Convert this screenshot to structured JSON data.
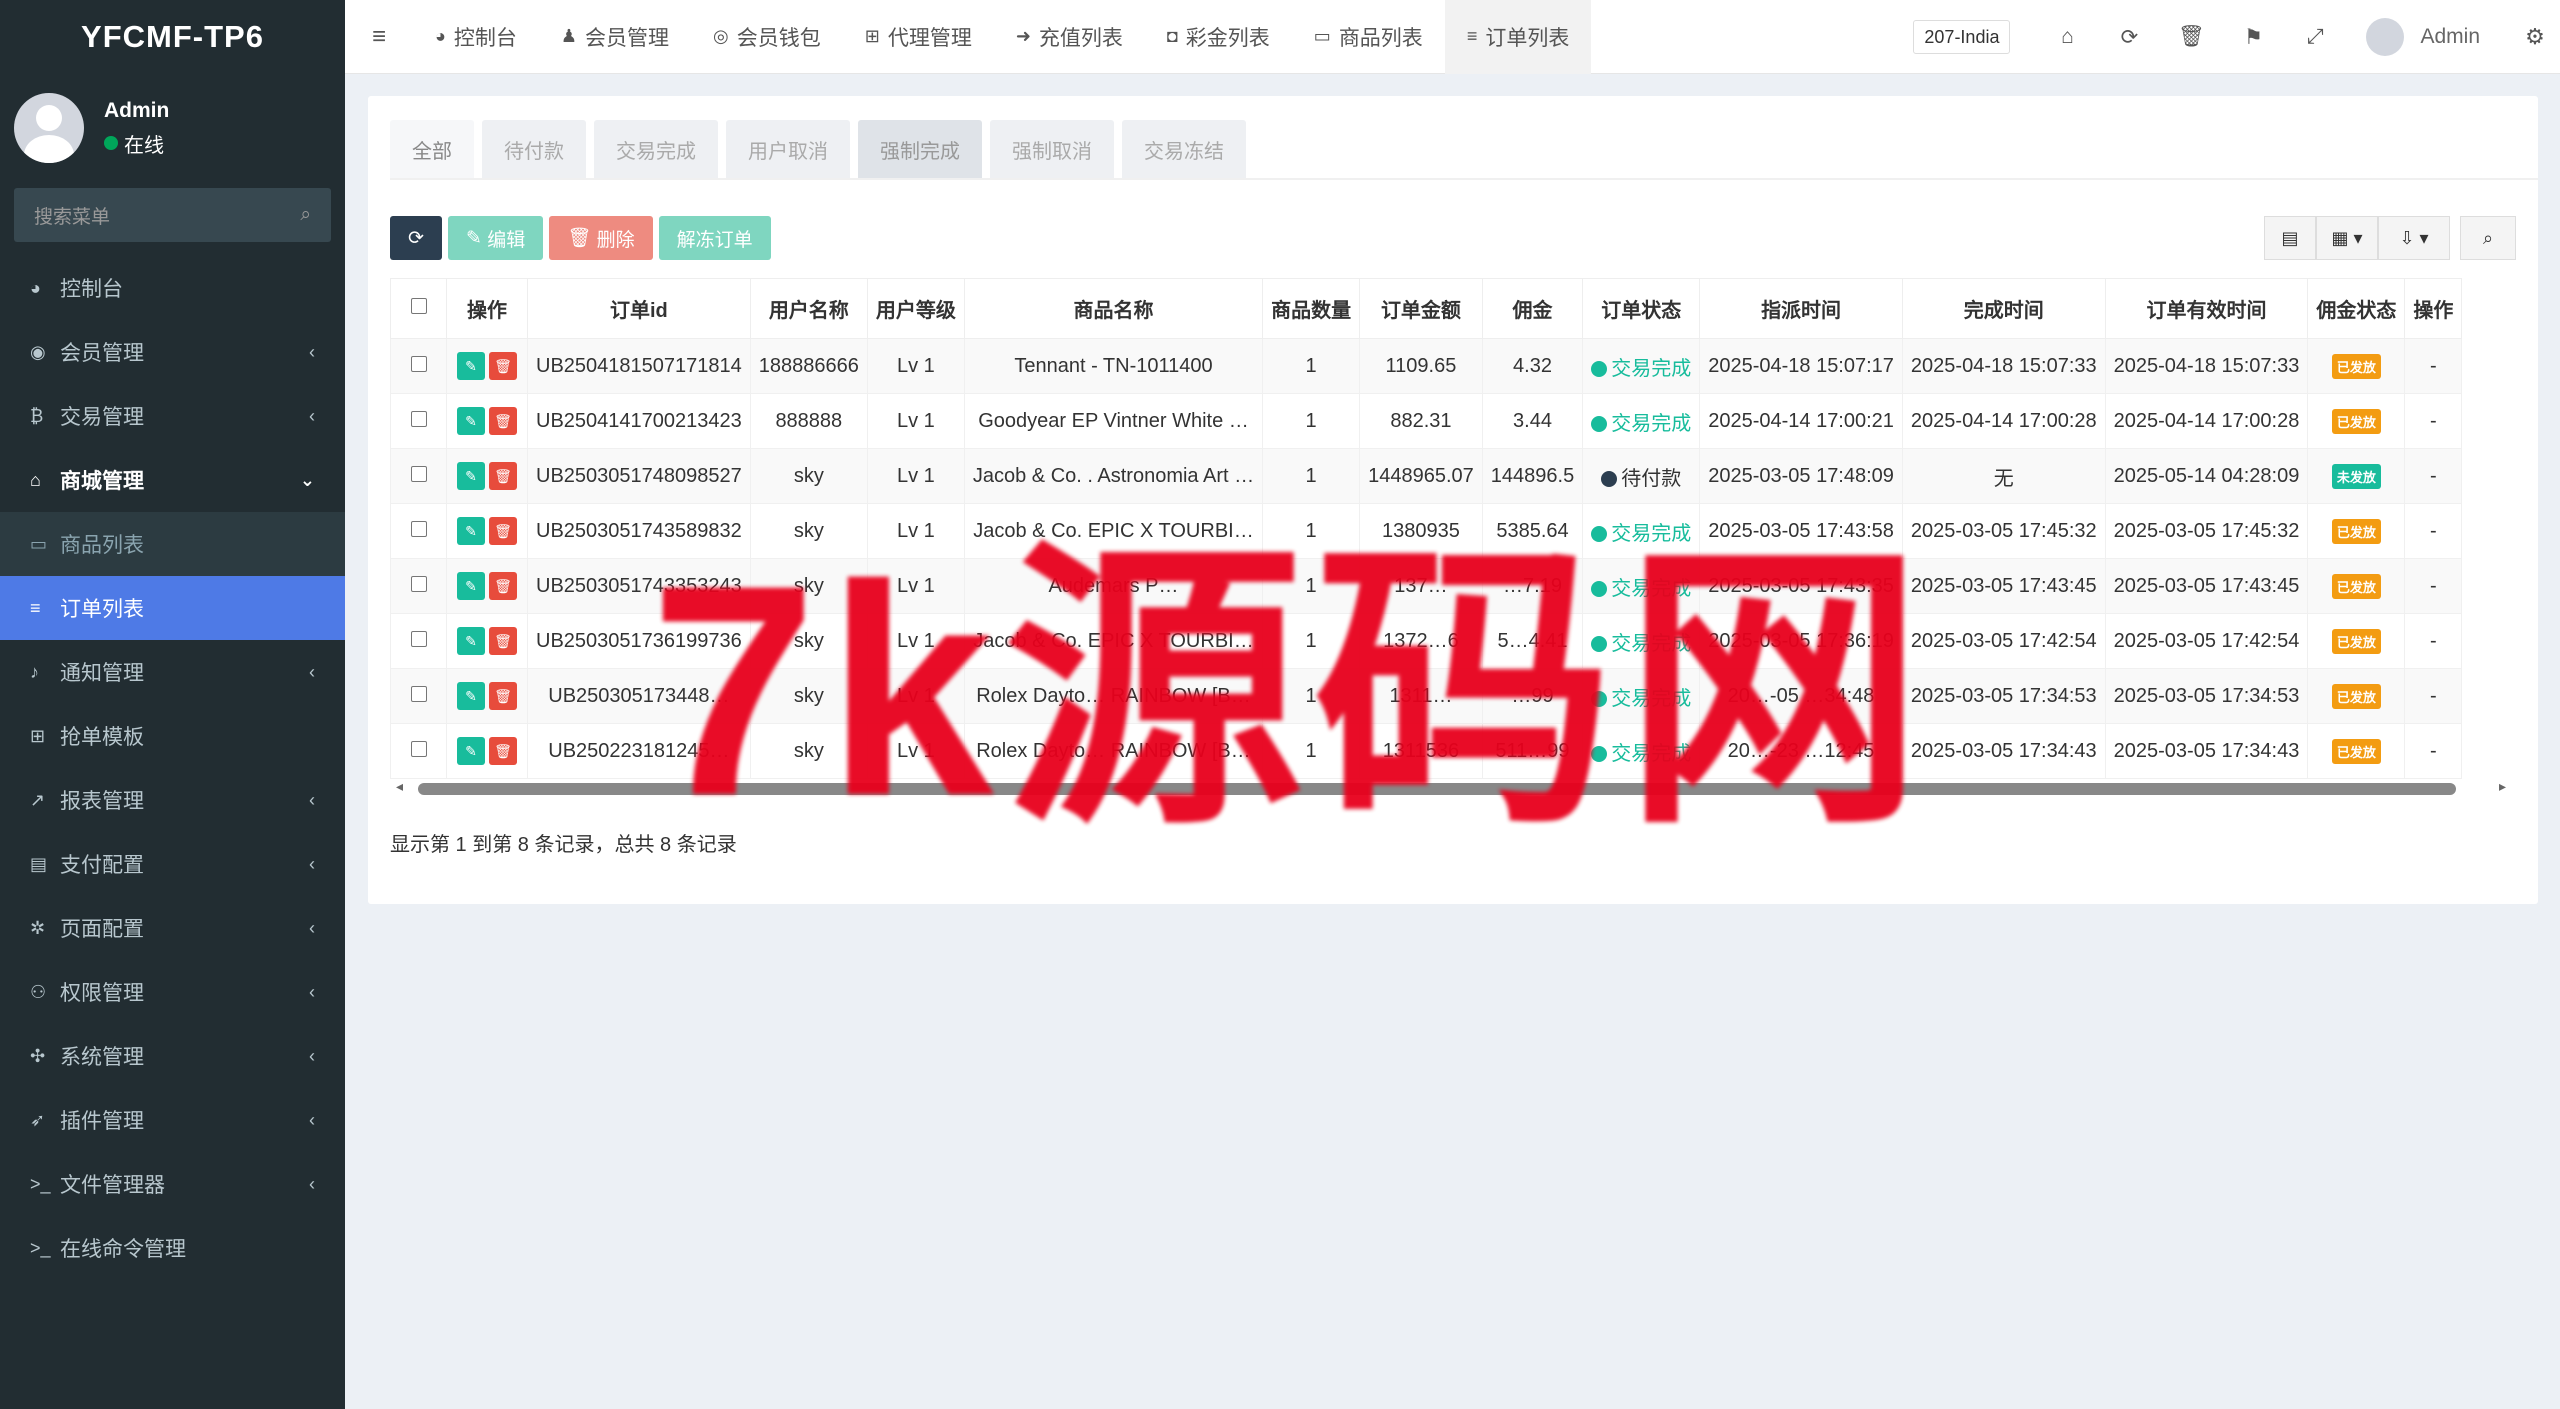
{
  "app": {
    "title": "YFCMF-TP6"
  },
  "user": {
    "name": "Admin",
    "status": "在线"
  },
  "search": {
    "placeholder": "搜索菜单"
  },
  "sidebar": {
    "items": [
      {
        "icon": "dashboard-icon",
        "glyph": "◕",
        "label": "控制台",
        "chevron": ""
      },
      {
        "icon": "user-circle-icon",
        "glyph": "◉",
        "label": "会员管理",
        "chevron": "‹"
      },
      {
        "icon": "bitcoin-icon",
        "glyph": "₿",
        "label": "交易管理",
        "chevron": "‹"
      },
      {
        "icon": "home-icon",
        "glyph": "⌂",
        "label": "商城管理",
        "chevron": "⌄"
      },
      {
        "icon": "monitor-icon",
        "glyph": "▭",
        "label": "商品列表",
        "chevron": ""
      },
      {
        "icon": "list-icon",
        "glyph": "≡",
        "label": "订单列表",
        "chevron": ""
      },
      {
        "icon": "bell-icon",
        "glyph": "♪",
        "label": "通知管理",
        "chevron": "‹"
      },
      {
        "icon": "sitemap-icon",
        "glyph": "⊞",
        "label": "抢单模板",
        "chevron": ""
      },
      {
        "icon": "chart-icon",
        "glyph": "↗",
        "label": "报表管理",
        "chevron": "‹"
      },
      {
        "icon": "credit-card-icon",
        "glyph": "▤",
        "label": "支付配置",
        "chevron": "‹"
      },
      {
        "icon": "gear-icon",
        "glyph": "✲",
        "label": "页面配置",
        "chevron": "‹"
      },
      {
        "icon": "users-icon",
        "glyph": "⚇",
        "label": "权限管理",
        "chevron": "‹"
      },
      {
        "icon": "cogs-icon",
        "glyph": "✣",
        "label": "系统管理",
        "chevron": "‹"
      },
      {
        "icon": "rocket-icon",
        "glyph": "➶",
        "label": "插件管理",
        "chevron": "‹"
      },
      {
        "icon": "terminal-icon",
        "glyph": ">_",
        "label": "文件管理器",
        "chevron": "‹"
      },
      {
        "icon": "terminal-icon",
        "glyph": ">_",
        "label": "在线命令管理",
        "chevron": ""
      }
    ]
  },
  "topnav": {
    "tabs": [
      {
        "icon": "dashboard-icon",
        "glyph": "◕",
        "label": "控制台"
      },
      {
        "icon": "user-icon",
        "glyph": "♟",
        "label": "会员管理"
      },
      {
        "icon": "wallet-icon",
        "glyph": "◎",
        "label": "会员钱包"
      },
      {
        "icon": "sitemap-icon",
        "glyph": "⊞",
        "label": "代理管理"
      },
      {
        "icon": "sign-in-icon",
        "glyph": "➜",
        "label": "充值列表"
      },
      {
        "icon": "gift-icon",
        "glyph": "◘",
        "label": "彩金列表"
      },
      {
        "icon": "monitor-icon",
        "glyph": "▭",
        "label": "商品列表"
      },
      {
        "icon": "list-icon",
        "glyph": "≡",
        "label": "订单列表"
      }
    ],
    "site": "207-India",
    "admin": "Admin"
  },
  "subtabs": [
    "全部",
    "待付款",
    "交易完成",
    "用户取消",
    "强制完成",
    "强制取消",
    "交易冻结"
  ],
  "toolbar": {
    "edit": "编辑",
    "delete": "删除",
    "unfreeze": "解冻订单"
  },
  "table": {
    "headers": [
      "操作",
      "订单id",
      "用户名称",
      "用户等级",
      "商品名称",
      "商品数量",
      "订单金额",
      "佣金",
      "订单状态",
      "指派时间",
      "完成时间",
      "订单有效时间",
      "佣金状态",
      "操作"
    ],
    "rows": [
      {
        "id": "UB2504181507171814",
        "user": "188886666",
        "level": "Lv 1",
        "product": "Tennant - TN-1011400",
        "qty": "1",
        "amount": "1109.65",
        "commission": "4.32",
        "status": "交易完成",
        "assigned": "2025-04-18 15:07:17",
        "completed": "2025-04-18 15:07:33",
        "valid": "2025-04-18 15:07:33",
        "cstatus": "已发放"
      },
      {
        "id": "UB2504141700213423",
        "user": "888888",
        "level": "Lv 1",
        "product": "Goodyear EP Vintner White …",
        "qty": "1",
        "amount": "882.31",
        "commission": "3.44",
        "status": "交易完成",
        "assigned": "2025-04-14 17:00:21",
        "completed": "2025-04-14 17:00:28",
        "valid": "2025-04-14 17:00:28",
        "cstatus": "已发放"
      },
      {
        "id": "UB2503051748098527",
        "user": "sky",
        "level": "Lv 1",
        "product": "Jacob & Co. . Astronomia Art …",
        "qty": "1",
        "amount": "1448965.07",
        "commission": "144896.5",
        "status": "待付款",
        "assigned": "2025-03-05 17:48:09",
        "completed": "无",
        "valid": "2025-05-14 04:28:09",
        "cstatus": "未发放"
      },
      {
        "id": "UB2503051743589832",
        "user": "sky",
        "level": "Lv 1",
        "product": "Jacob & Co. EPIC X TOURBI…",
        "qty": "1",
        "amount": "1380935",
        "commission": "5385.64",
        "status": "交易完成",
        "assigned": "2025-03-05 17:43:58",
        "completed": "2025-03-05 17:45:32",
        "valid": "2025-03-05 17:45:32",
        "cstatus": "已发放"
      },
      {
        "id": "UB2503051743353243",
        "user": "sky",
        "level": "Lv 1",
        "product": "Audemars P…",
        "qty": "1",
        "amount": "137…",
        "commission": "…7.19",
        "status": "交易完成",
        "assigned": "2025-03-05 17:43:35",
        "completed": "2025-03-05 17:43:45",
        "valid": "2025-03-05 17:43:45",
        "cstatus": "已发放"
      },
      {
        "id": "UB2503051736199736",
        "user": "sky",
        "level": "Lv 1",
        "product": "Jacob & Co. EPIC X TOURBI…",
        "qty": "1",
        "amount": "1372…6",
        "commission": "5…4.41",
        "status": "交易完成",
        "assigned": "2025-03-05 17:36:19",
        "completed": "2025-03-05 17:42:54",
        "valid": "2025-03-05 17:42:54",
        "cstatus": "已发放"
      },
      {
        "id": "UB250305173448…",
        "user": "sky",
        "level": "Lv 1",
        "product": "Rolex Dayto… RAINBOW [B…",
        "qty": "1",
        "amount": "1311…",
        "commission": "…99",
        "status": "交易完成",
        "assigned": "20…-05 …34:48",
        "completed": "2025-03-05 17:34:53",
        "valid": "2025-03-05 17:34:53",
        "cstatus": "已发放"
      },
      {
        "id": "UB250223181245…",
        "user": "sky",
        "level": "Lv 1",
        "product": "Rolex Dayto… RAINBOW [B…",
        "qty": "1",
        "amount": "1311536",
        "commission": "511…99",
        "status": "交易完成",
        "assigned": "20…-23 …12:45",
        "completed": "2025-03-05 17:34:43",
        "valid": "2025-03-05 17:34:43",
        "cstatus": "已发放"
      }
    ]
  },
  "pager": {
    "info": "显示第 1 到第 8 条记录，总共 8 条记录"
  },
  "watermark": "7k源码网",
  "colors": {
    "sidebar": "#222d32",
    "accent": "#4e7ae6",
    "success": "#18bc9c",
    "danger": "#e74c3c",
    "warning": "#f39c12"
  }
}
